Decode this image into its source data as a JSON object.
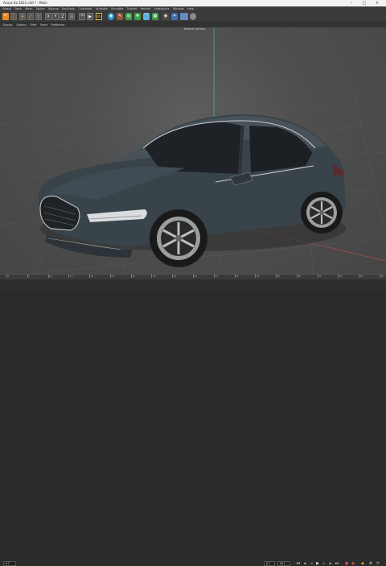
{
  "window": {
    "title": "Acura tlx 2021.c4d * - Main",
    "controls": [
      "minimize-icon",
      "maximize-icon",
      "close-icon"
    ]
  },
  "menubar": {
    "items": [
      "Select",
      "Tools",
      "Mesh",
      "Spline",
      "Volume",
      "MoGraph",
      "Character",
      "Animate",
      "Simulate",
      "Tracker",
      "Render",
      "Extensions",
      "Window",
      "Help"
    ]
  },
  "toolbar": {
    "icons": [
      "undo-icon",
      "live-selection-icon",
      "move-icon",
      "scale-icon",
      "rotate-icon",
      "x-axis-icon",
      "y-axis-icon",
      "z-axis-icon",
      "coordinate-system-icon",
      "render-view-icon",
      "render-picture-viewer-icon",
      "render-settings-icon",
      "cube-icon",
      "pen-icon",
      "subdivision-icon",
      "array-icon",
      "bend-icon",
      "floor-icon",
      "camera-icon",
      "light-icon"
    ],
    "axis_labels": [
      "X",
      "Y",
      "Z"
    ]
  },
  "view_menu": {
    "items": [
      "Display",
      "Options",
      "Filter",
      "Panel",
      "ProRender"
    ]
  },
  "viewport": {
    "camera_label": "Default Camera"
  },
  "timeline": {
    "ticks": [
      "0",
      "5",
      "10",
      "15",
      "20",
      "25",
      "30",
      "35",
      "40",
      "45",
      "50",
      "55",
      "60",
      "65",
      "70",
      "75",
      "80",
      "85",
      "90"
    ]
  },
  "transport": {
    "current_frame": "0 F",
    "start_frame": "0 F",
    "end_frame": "90 F"
  },
  "colors": {
    "accent": "#2e9fd8",
    "car_body": "#39434a",
    "world_axis_green": "#3cc06a",
    "world_axis_red": "#b04b4b"
  }
}
